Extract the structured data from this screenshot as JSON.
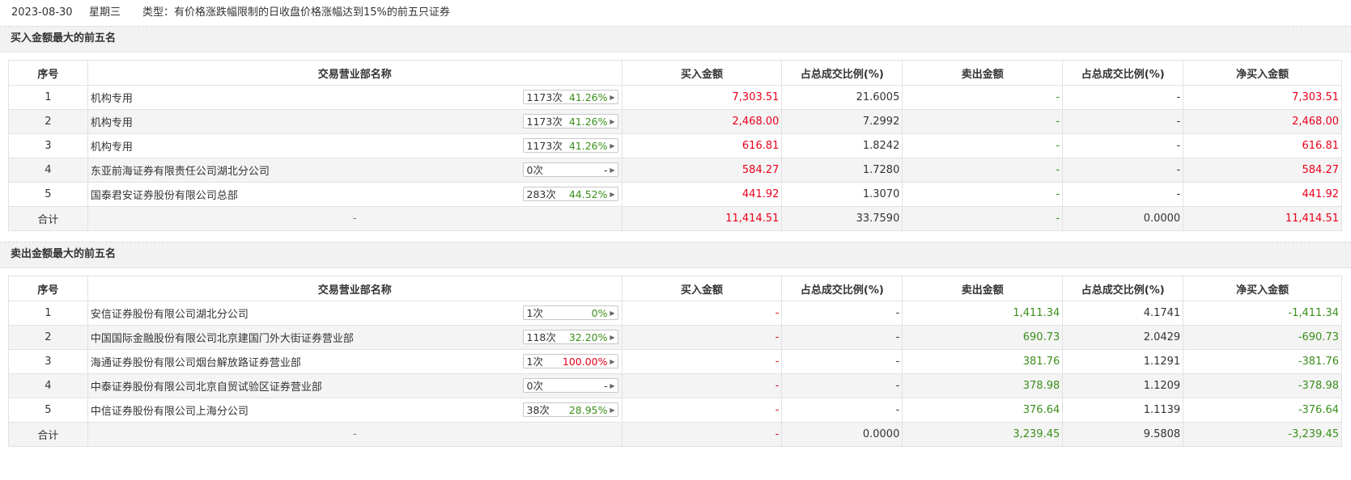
{
  "header": {
    "date": "2023-08-30",
    "weekday": "星期三",
    "type_text": "类型：有价格涨跌幅限制的日收盘价格涨幅达到15%的前五只证券"
  },
  "colors": {
    "up": "#e8001c",
    "down": "#3b8f1b"
  },
  "columns": [
    "序号",
    "交易营业部名称",
    "买入金额",
    "占总成交比例(%)",
    "卖出金额",
    "占总成交比例(%)",
    "净买入金额"
  ],
  "buy_section": {
    "title": "买入金额最大的前五名",
    "rows": [
      {
        "idx": "1",
        "name": "机构专用",
        "count": "1173次",
        "pct": "41.26%",
        "pct_color": "green",
        "buy": "7,303.51",
        "buy_ratio": "21.6005",
        "sell": "-",
        "sell_ratio": "-",
        "net": "7,303.51"
      },
      {
        "idx": "2",
        "name": "机构专用",
        "count": "1173次",
        "pct": "41.26%",
        "pct_color": "green",
        "buy": "2,468.00",
        "buy_ratio": "7.2992",
        "sell": "-",
        "sell_ratio": "-",
        "net": "2,468.00"
      },
      {
        "idx": "3",
        "name": "机构专用",
        "count": "1173次",
        "pct": "41.26%",
        "pct_color": "green",
        "buy": "616.81",
        "buy_ratio": "1.8242",
        "sell": "-",
        "sell_ratio": "-",
        "net": "616.81"
      },
      {
        "idx": "4",
        "name": "东亚前海证券有限责任公司湖北分公司",
        "count": "0次",
        "pct": "-",
        "pct_color": "dark",
        "buy": "584.27",
        "buy_ratio": "1.7280",
        "sell": "-",
        "sell_ratio": "-",
        "net": "584.27"
      },
      {
        "idx": "5",
        "name": "国泰君安证券股份有限公司总部",
        "count": "283次",
        "pct": "44.52%",
        "pct_color": "green",
        "buy": "441.92",
        "buy_ratio": "1.3070",
        "sell": "-",
        "sell_ratio": "-",
        "net": "441.92"
      }
    ],
    "total": {
      "label": "合计",
      "name": "-",
      "buy": "11,414.51",
      "buy_ratio": "33.7590",
      "sell": "-",
      "sell_ratio": "0.0000",
      "net": "11,414.51"
    }
  },
  "sell_section": {
    "title": "卖出金额最大的前五名",
    "rows": [
      {
        "idx": "1",
        "name": "安信证券股份有限公司湖北分公司",
        "count": "1次",
        "pct": "0%",
        "pct_color": "green",
        "buy": "-",
        "buy_ratio": "-",
        "sell": "1,411.34",
        "sell_ratio": "4.1741",
        "net": "-1,411.34"
      },
      {
        "idx": "2",
        "name": "中国国际金融股份有限公司北京建国门外大街证券营业部",
        "count": "118次",
        "pct": "32.20%",
        "pct_color": "green",
        "buy": "-",
        "buy_ratio": "-",
        "sell": "690.73",
        "sell_ratio": "2.0429",
        "net": "-690.73"
      },
      {
        "idx": "3",
        "name": "海通证券股份有限公司烟台解放路证券营业部",
        "count": "1次",
        "pct": "100.00%",
        "pct_color": "red",
        "buy": "-",
        "buy_ratio": "-",
        "sell": "381.76",
        "sell_ratio": "1.1291",
        "net": "-381.76"
      },
      {
        "idx": "4",
        "name": "中泰证券股份有限公司北京自贸试验区证券营业部",
        "count": "0次",
        "pct": "-",
        "pct_color": "dark",
        "buy": "-",
        "buy_ratio": "-",
        "sell": "378.98",
        "sell_ratio": "1.1209",
        "net": "-378.98"
      },
      {
        "idx": "5",
        "name": "中信证券股份有限公司上海分公司",
        "count": "38次",
        "pct": "28.95%",
        "pct_color": "green",
        "buy": "-",
        "buy_ratio": "-",
        "sell": "376.64",
        "sell_ratio": "1.1139",
        "net": "-376.64"
      }
    ],
    "total": {
      "label": "合计",
      "name": "-",
      "buy": "-",
      "buy_ratio": "0.0000",
      "sell": "3,239.45",
      "sell_ratio": "9.5808",
      "net": "-3,239.45"
    }
  }
}
